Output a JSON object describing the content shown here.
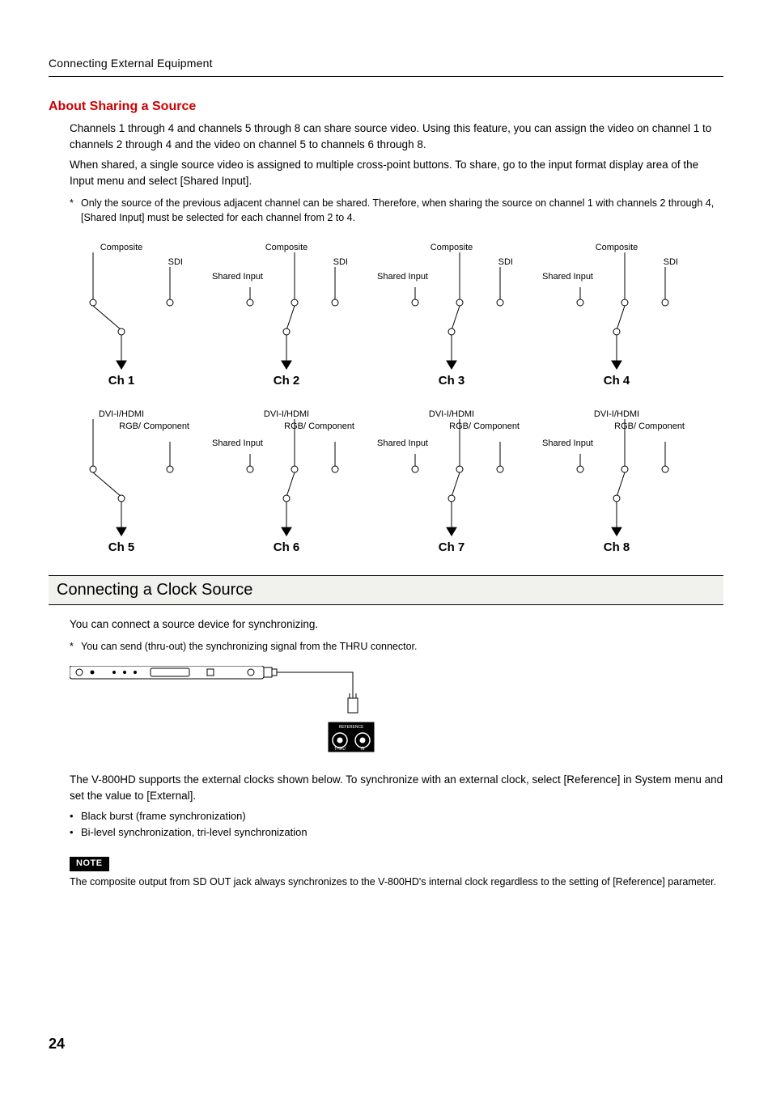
{
  "header": {
    "breadcrumb": "Connecting External Equipment"
  },
  "sharing": {
    "title": "About Sharing a Source",
    "p1": "Channels 1 through 4 and channels 5 through 8 can share source video. Using this feature, you can assign the video on channel 1 to channels 2 through 4 and the video on channel 5 to channels 6 through 8.",
    "p2": "When shared, a single source video is assigned to multiple cross-point buttons. To share, go to the input format display area of the Input menu and select [Shared Input].",
    "note": "Only the source of the previous adjacent channel can be shared. Therefore, when sharing the source on channel 1 with channels 2 through 4, [Shared Input] must be selected for each channel from 2 to 4."
  },
  "labels": {
    "composite": "Composite",
    "sdi": "SDI",
    "shared_input": "Shared Input",
    "dvi": "DVI-I/HDMI",
    "rgb": "RGB/ Component"
  },
  "channels_top": [
    "Ch 1",
    "Ch 2",
    "Ch 3",
    "Ch 4"
  ],
  "channels_bottom": [
    "Ch 5",
    "Ch 6",
    "Ch 7",
    "Ch 8"
  ],
  "clock": {
    "title": "Connecting a Clock Source",
    "p1": "You can connect a source device for synchronizing.",
    "note": "You can send (thru-out) the synchronizing signal from the THRU connector.",
    "p2": "The V-800HD supports the external clocks shown below. To synchronize with an external clock, select [Reference] in System menu and set the value to [External].",
    "bullets": [
      "Black burst (frame synchronization)",
      "Bi-level synchronization, tri-level synchronization"
    ],
    "note_badge": "NOTE",
    "note_text": "The composite output from SD OUT jack always synchronizes to the V-800HD's internal clock regardless to the setting of [Reference] parameter.",
    "panel_label": "REFERENCE",
    "panel_thru": "THRU",
    "panel_in": "IN"
  },
  "page_number": "24"
}
